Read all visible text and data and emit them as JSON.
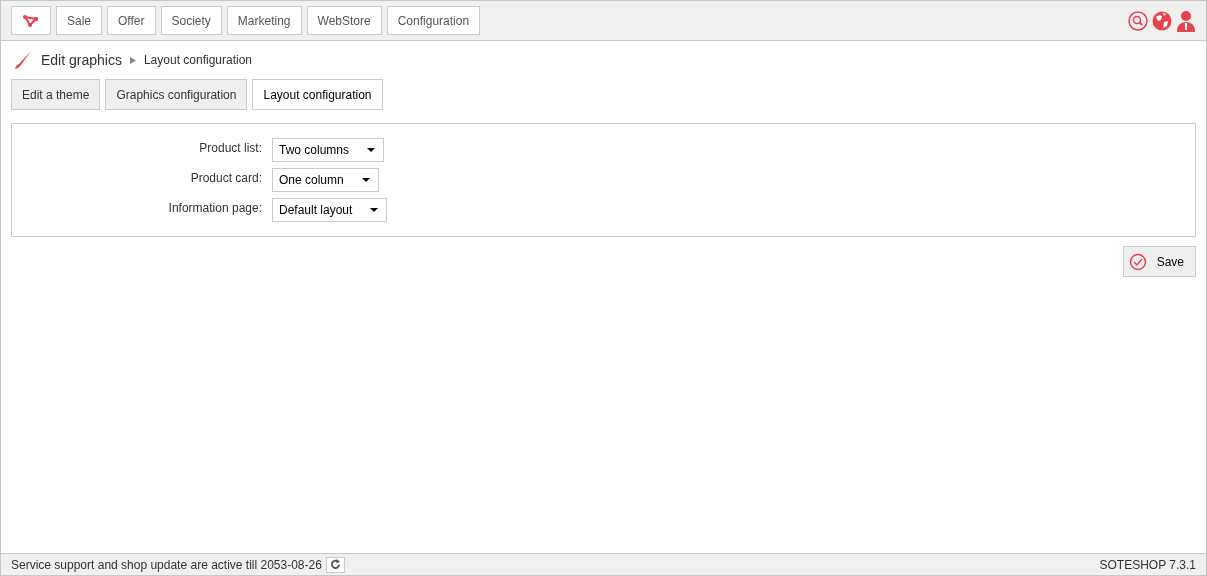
{
  "menu": [
    "Sale",
    "Offer",
    "Society",
    "Marketing",
    "WebStore",
    "Configuration"
  ],
  "breadcrumb": {
    "title": "Edit graphics",
    "current": "Layout configuration"
  },
  "tabs": [
    {
      "label": "Edit a theme",
      "selected": false
    },
    {
      "label": "Graphics configuration",
      "selected": false
    },
    {
      "label": "Layout configuration",
      "selected": true
    }
  ],
  "form": [
    {
      "label": "Product list:",
      "value": "Two columns"
    },
    {
      "label": "Product card:",
      "value": "One column"
    },
    {
      "label": "Information page:",
      "value": "Default layout"
    }
  ],
  "save_button": "Save",
  "status_bar": {
    "message": "Service support and shop update are active till 2053-08-26",
    "version": "SOTESHOP 7.3.1"
  }
}
